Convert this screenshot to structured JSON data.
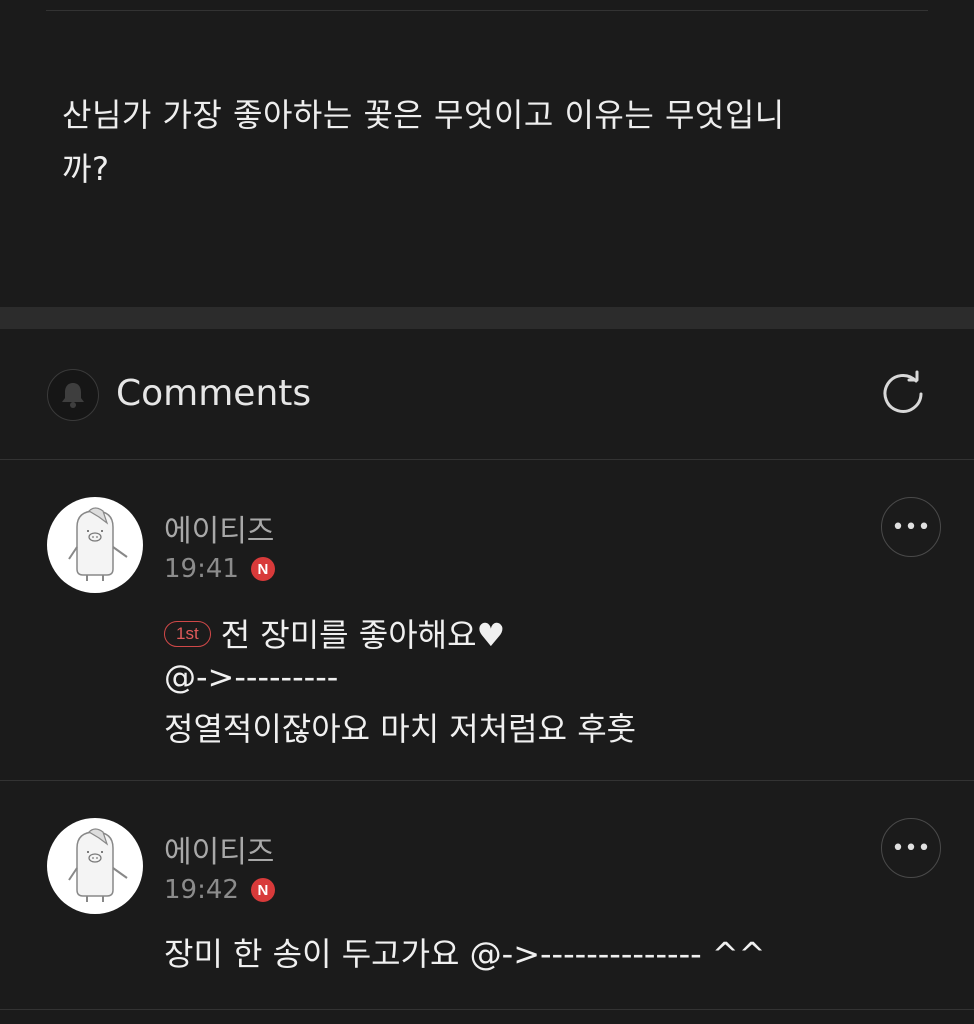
{
  "post": {
    "question": "산님가 가장 좋아하는 꽃은 무엇이고 이유는 무엇입니\n까?"
  },
  "comments_section": {
    "title": "Comments",
    "icons": {
      "bell": "bell-icon",
      "refresh": "refresh-icon"
    }
  },
  "comments": [
    {
      "author": "에이티즈",
      "time": "19:41",
      "new_badge": "N",
      "rank_badge": "1st",
      "lines": [
        "전 장미를 좋아해요♥",
        "@->---------",
        "정열적이잖아요 마치 저처럼요 후훗"
      ]
    },
    {
      "author": "에이티즈",
      "time": "19:42",
      "new_badge": "N",
      "lines": [
        "장미 한 송이 두고가요 @->-------------- ^^"
      ]
    }
  ],
  "colors": {
    "background": "#1b1b1b",
    "badge_red": "#d83a3a",
    "rank_red": "#d04848"
  }
}
